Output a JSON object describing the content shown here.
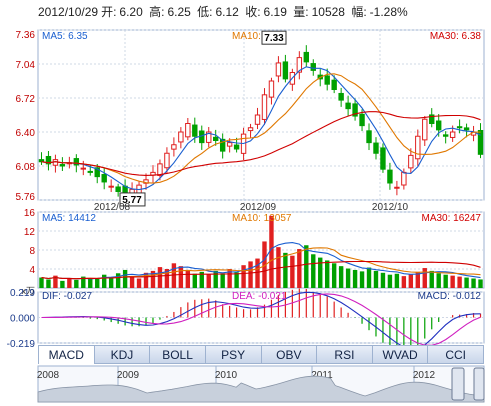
{
  "header": {
    "date": "2012/10/29",
    "open_label": "开:",
    "open": "6.20",
    "high_label": "高:",
    "high": "6.25",
    "low_label": "低:",
    "low": "6.12",
    "close_label": "收:",
    "close": "6.19",
    "vol_label": "量:",
    "vol": "10528",
    "chg_label": "幅:",
    "chg": "-1.28%"
  },
  "price_panel": {
    "ma5": "MA5: 6.35",
    "ma10": "MA10: 6.38",
    "ma30": "MA30: 6.38",
    "yticks": [
      "7.36",
      "7.04",
      "6.72",
      "6.40",
      "6.08",
      "5.76"
    ],
    "peak_label": "7.33",
    "trough_label": "5.77",
    "xticks": [
      "2012/08",
      "2012/09",
      "2012/10"
    ]
  },
  "volume_panel": {
    "ma5": "MA5: 14412",
    "ma10": "MA10: 13057",
    "ma30": "MA30: 16247",
    "yticks": [
      "16",
      "12",
      "8",
      "4"
    ],
    "unit": "x万"
  },
  "macd_panel": {
    "dif": "DIF: -0.027",
    "dea": "DEA: -0.021",
    "macd": "MACD: -0.012",
    "yticks": [
      "0.219",
      "0.000",
      "-0.219"
    ]
  },
  "tabs": [
    "MACD",
    "KDJ",
    "BOLL",
    "PSY",
    "OBV",
    "RSI",
    "WVAD",
    "CCI"
  ],
  "timeline": {
    "years": [
      "2008",
      "2009",
      "2010",
      "2011",
      "2012"
    ]
  },
  "colors": {
    "up": "#e02020",
    "down": "#00a000",
    "ma5": "#1a5fd0",
    "ma10": "#e07800",
    "ma30": "#d00000",
    "grid": "#cfd8e6"
  },
  "chart_data": [
    {
      "type": "candlestick",
      "title": "",
      "ylim": [
        5.76,
        7.36
      ],
      "yticks": [
        7.36,
        7.04,
        6.72,
        6.4,
        6.08,
        5.76
      ],
      "xticks": [
        "2012/08",
        "2012/09",
        "2012/10"
      ],
      "annotations": [
        {
          "label": "7.33",
          "value": 7.33
        },
        {
          "label": "5.77",
          "value": 5.77
        }
      ],
      "series": [
        {
          "name": "MA5",
          "last": 6.35
        },
        {
          "name": "MA10",
          "last": 6.38
        },
        {
          "name": "MA30",
          "last": 6.38
        }
      ]
    },
    {
      "type": "bar",
      "title": "",
      "ylim": [
        0,
        16
      ],
      "yticks": [
        16,
        12,
        8,
        4
      ],
      "ylabel": "x万",
      "series": [
        {
          "name": "MA5",
          "last": 14412
        },
        {
          "name": "MA10",
          "last": 13057
        },
        {
          "name": "MA30",
          "last": 16247
        }
      ]
    },
    {
      "type": "bar",
      "title": "",
      "ylim": [
        -0.219,
        0.219
      ],
      "yticks": [
        0.219,
        0.0,
        -0.219
      ],
      "series": [
        {
          "name": "DIF",
          "last": -0.027
        },
        {
          "name": "DEA",
          "last": -0.021
        },
        {
          "name": "MACD",
          "last": -0.012
        }
      ]
    }
  ]
}
